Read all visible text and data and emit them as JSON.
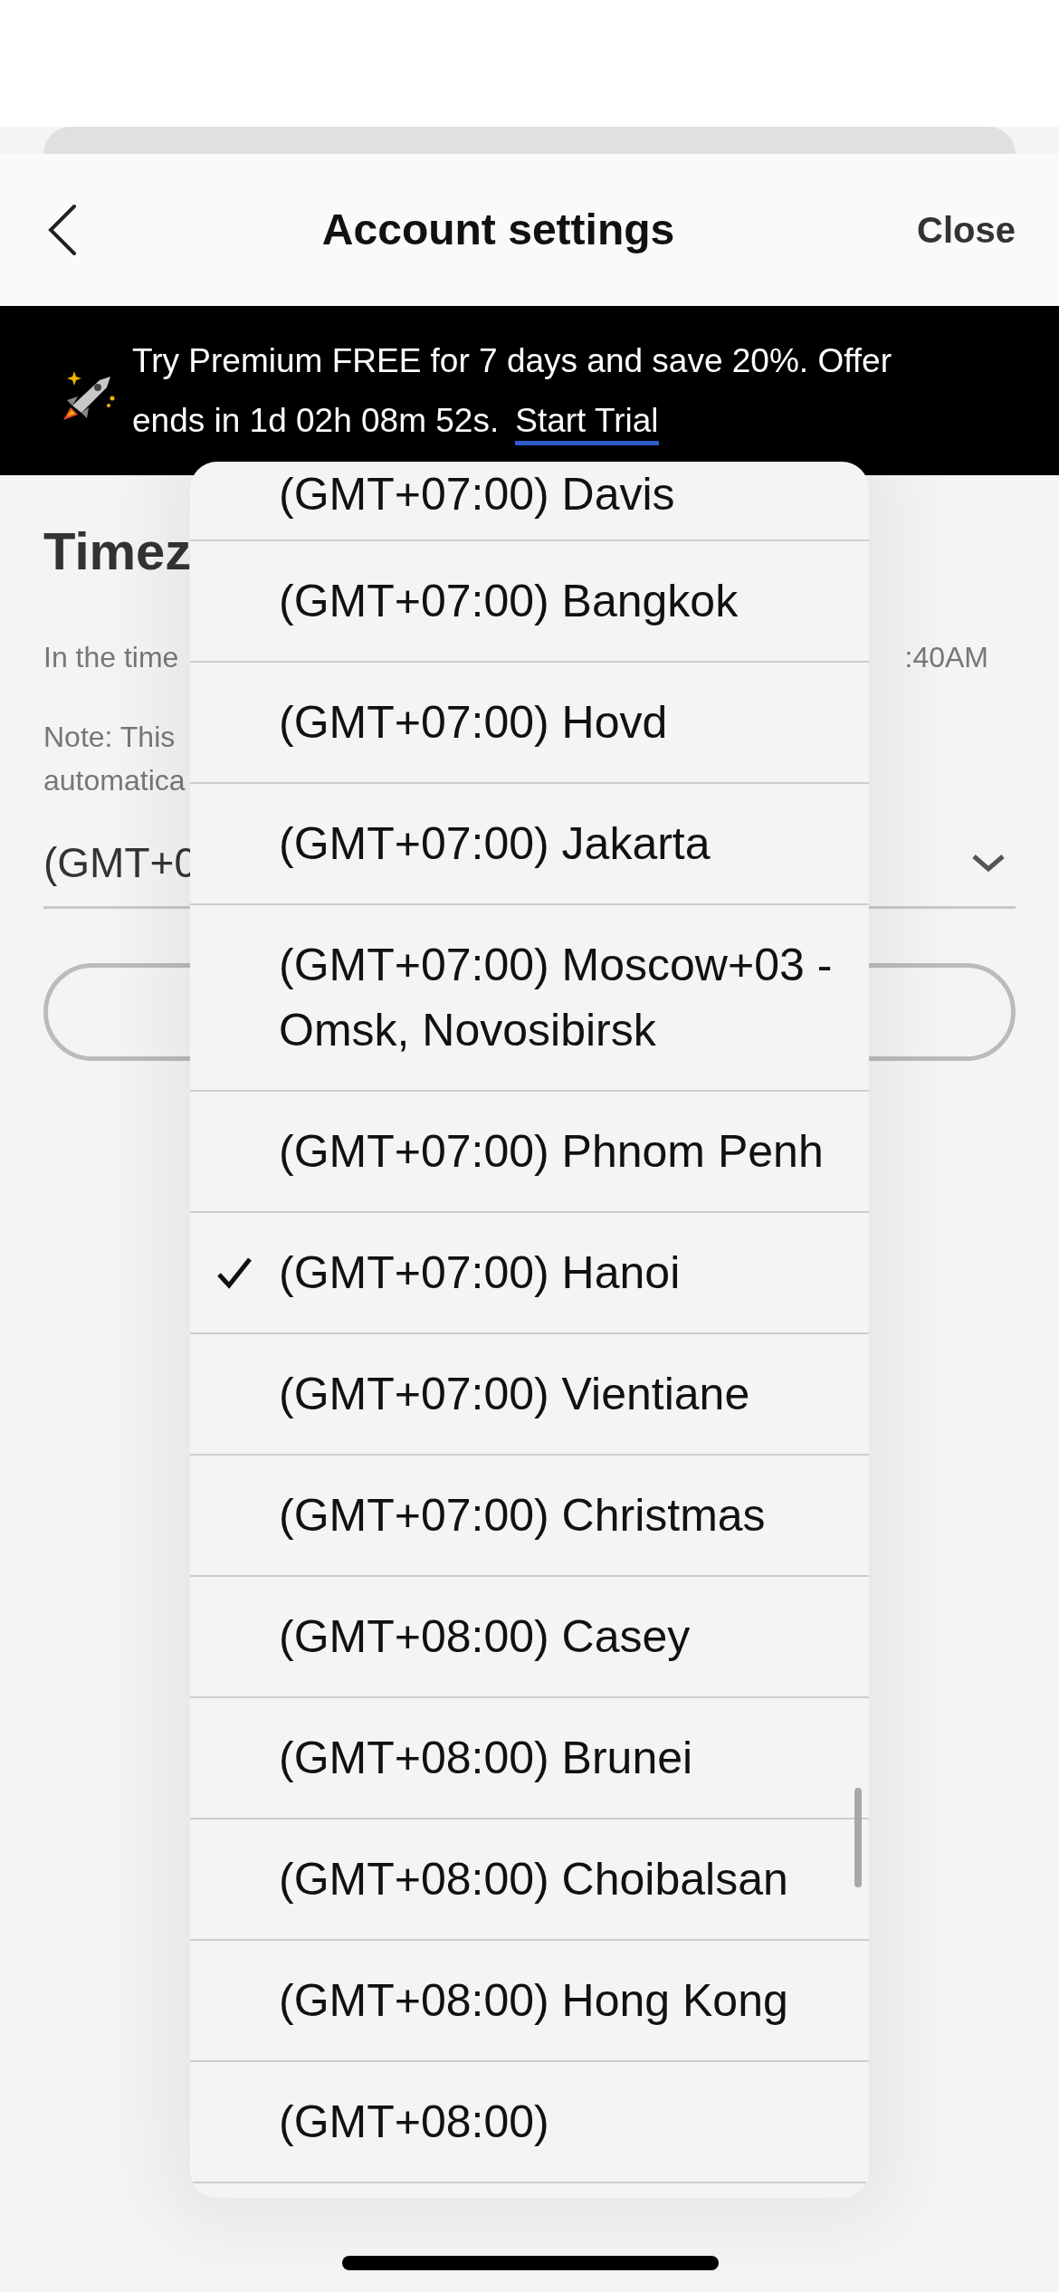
{
  "header": {
    "title": "Account settings",
    "close": "Close"
  },
  "banner": {
    "text": "Try Premium FREE for 7 days and save 20%. Offer ends in 1d 02h 08m 52s.",
    "link": "Start Trial"
  },
  "section": {
    "heading": "Timez",
    "line_left": "In the time",
    "line_right": ":40AM",
    "note_lines": [
      "Note: This",
      "automatica"
    ],
    "select_value": "(GMT+0"
  },
  "dropdown": {
    "options": [
      {
        "label": "(GMT+07:00) Davis",
        "selected": false
      },
      {
        "label": "(GMT+07:00) Bangkok",
        "selected": false
      },
      {
        "label": "(GMT+07:00) Hovd",
        "selected": false
      },
      {
        "label": "(GMT+07:00) Jakarta",
        "selected": false
      },
      {
        "label": "(GMT+07:00) Moscow+03 - Omsk, Novosibirsk",
        "selected": false
      },
      {
        "label": "(GMT+07:00) Phnom Penh",
        "selected": false
      },
      {
        "label": "(GMT+07:00) Hanoi",
        "selected": true
      },
      {
        "label": "(GMT+07:00) Vientiane",
        "selected": false
      },
      {
        "label": "(GMT+07:00) Christmas",
        "selected": false
      },
      {
        "label": "(GMT+08:00) Casey",
        "selected": false
      },
      {
        "label": "(GMT+08:00) Brunei",
        "selected": false
      },
      {
        "label": "(GMT+08:00) Choibalsan",
        "selected": false
      },
      {
        "label": "(GMT+08:00) Hong Kong",
        "selected": false
      },
      {
        "label": "(GMT+08:00)",
        "selected": false
      }
    ]
  }
}
